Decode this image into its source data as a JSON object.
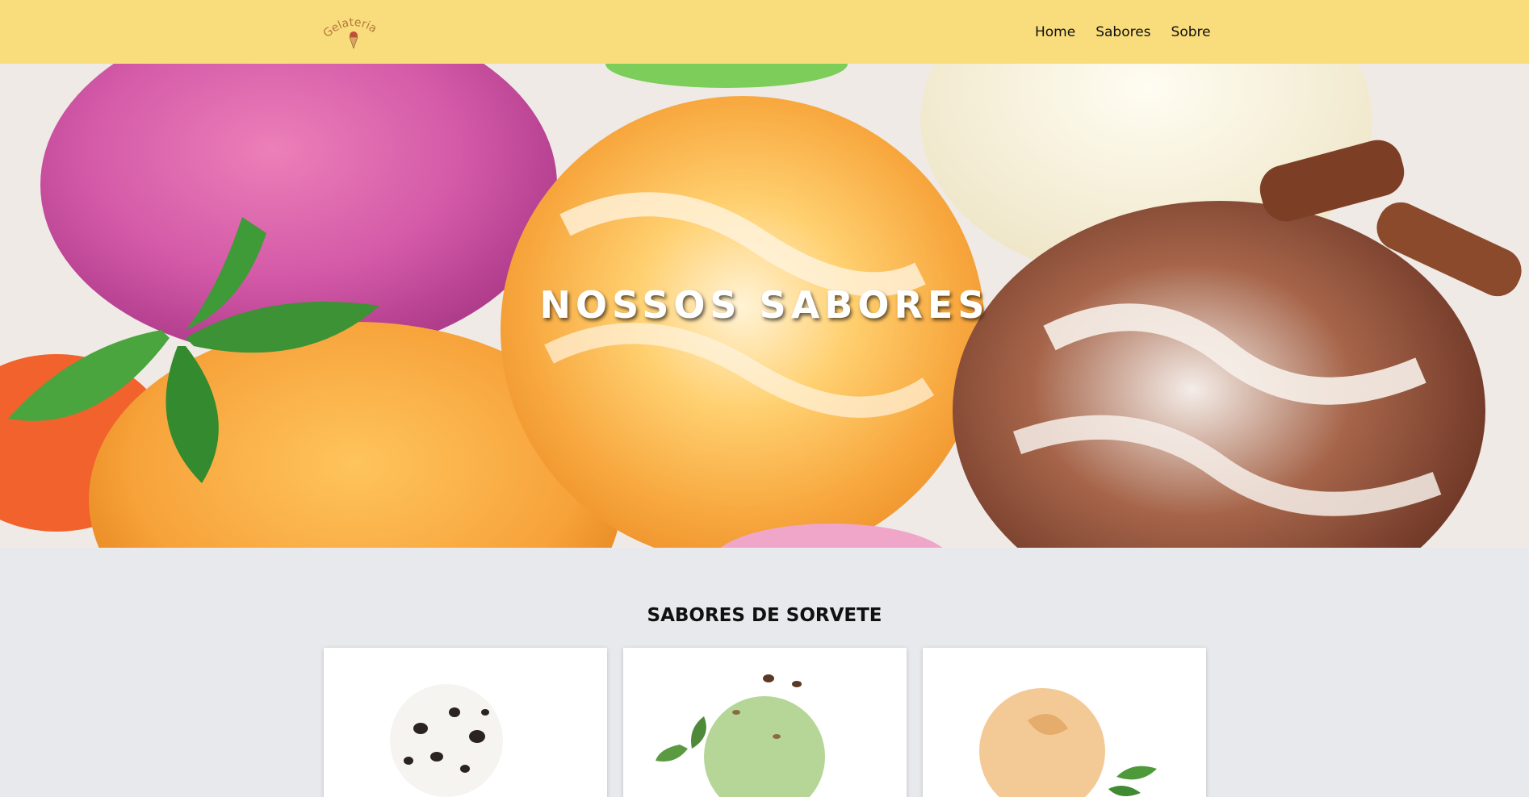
{
  "header": {
    "logo_text": "Gelateria",
    "nav": [
      {
        "label": "Home"
      },
      {
        "label": "Sabores"
      },
      {
        "label": "Sobre"
      }
    ]
  },
  "hero": {
    "title": "NOSSOS SABORES"
  },
  "flavors": {
    "title": "SABORES DE SORVETE"
  },
  "colors": {
    "header_bg": "#f9dd7c",
    "page_bg": "#e8e9ec",
    "logo": "#b5783c"
  }
}
